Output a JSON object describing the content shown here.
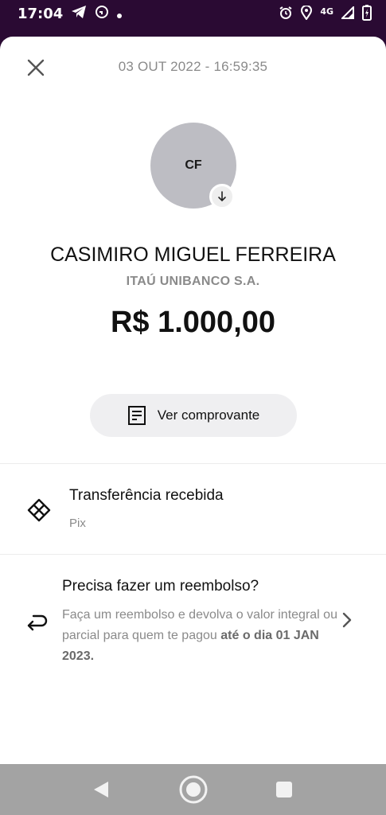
{
  "status_bar": {
    "time": "17:04",
    "network": "4G",
    "icons": [
      "telegram-icon",
      "cast-icon",
      "dot-icon",
      "alarm-icon",
      "location-icon",
      "signal-icon",
      "battery-icon"
    ]
  },
  "header": {
    "date": "03 OUT 2022 - 16:59:35",
    "close_icon": "close-icon"
  },
  "payer": {
    "initials": "CF",
    "name": "CASIMIRO MIGUEL FERREIRA",
    "bank": "ITAÚ UNIBANCO S.A.",
    "amount": "R$ 1.000,00"
  },
  "receipt_button": {
    "label": "Ver comprovante",
    "icon": "receipt-icon"
  },
  "transaction": {
    "title": "Transferência recebida",
    "method": "Pix",
    "icon": "pix-icon"
  },
  "refund": {
    "title": "Precisa fazer um reembolso?",
    "text": "Faça um reembolso e devolva o valor integral ou parcial para quem te pagou",
    "deadline": "até o dia 01 JAN 2023.",
    "icon": "refund-arrow-icon"
  },
  "colors": {
    "status_bar_bg": "#2a0a33",
    "avatar_bg": "#bdbdc3",
    "button_bg": "#efeff1",
    "muted_text": "#8a8a8a",
    "nav_bar_bg": "#a3a3a3"
  }
}
